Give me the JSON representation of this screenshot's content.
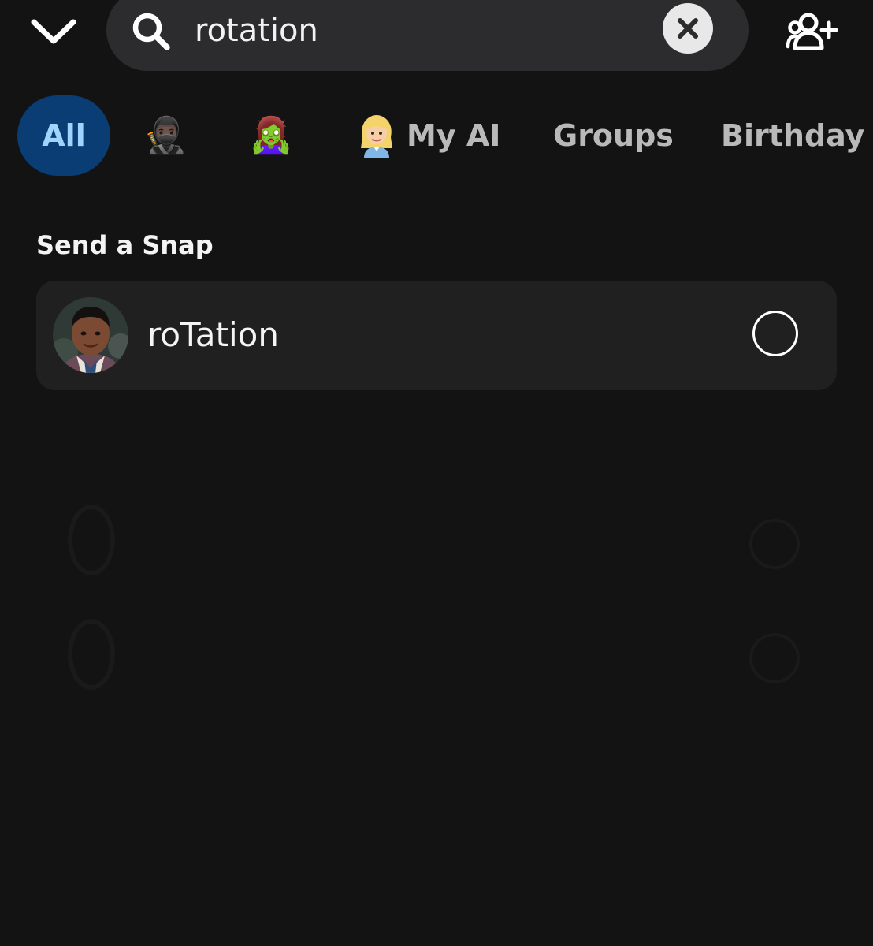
{
  "header": {
    "back_icon": "chevron-down-icon",
    "search": {
      "value": "rotation",
      "icon": "search-icon",
      "clear_icon": "close-icon"
    },
    "add_friend_icon": "add-friend-icon"
  },
  "filters": {
    "active": "All",
    "items": [
      {
        "label": "All",
        "type": "text"
      },
      {
        "label": "🥷🏿",
        "type": "emoji"
      },
      {
        "label": "🧟‍♀️",
        "type": "emoji"
      },
      {
        "label": "My AI",
        "type": "text-with-avatar"
      },
      {
        "label": "Groups",
        "type": "text"
      },
      {
        "label": "Birthday",
        "type": "text"
      }
    ]
  },
  "send_snap": {
    "title": "Send a Snap",
    "contacts": [
      {
        "name": "roTation",
        "selected": false
      }
    ]
  },
  "colors": {
    "background": "#131313",
    "card": "#202021",
    "chip_active_bg": "#0a3d73",
    "chip_active_text": "#9fd4ff",
    "search_bg": "#2c2c2e"
  }
}
